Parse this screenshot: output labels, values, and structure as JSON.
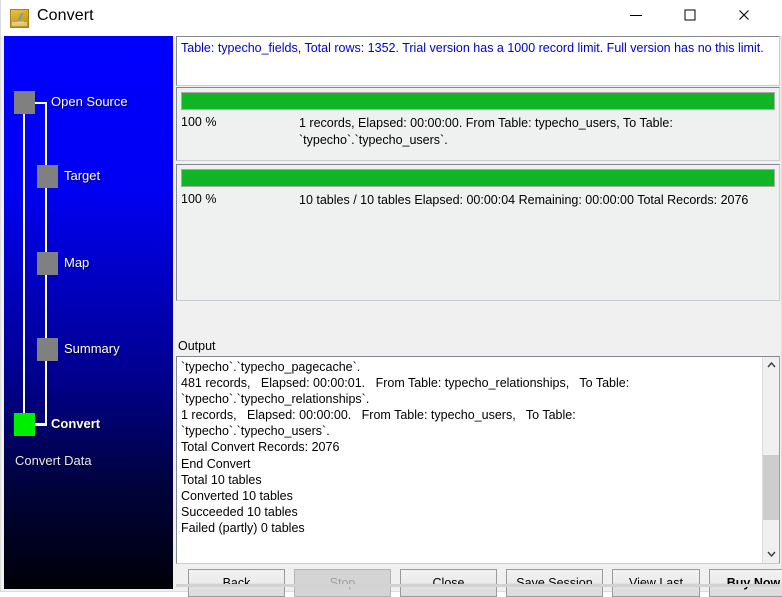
{
  "window": {
    "title": "Convert",
    "icon": "mysql-dolphin-icon",
    "caption_buttons": [
      {
        "name": "minimize-button",
        "glyph": "minimize-icon"
      },
      {
        "name": "maximize-button",
        "glyph": "maximize-icon"
      },
      {
        "name": "close-button",
        "glyph": "close-icon"
      }
    ]
  },
  "sidebar": {
    "footer_label": "Convert Data",
    "steps": [
      {
        "label": "Open Source",
        "state": "done"
      },
      {
        "label": "Target",
        "state": "done"
      },
      {
        "label": "Map",
        "state": "done"
      },
      {
        "label": "Summary",
        "state": "done"
      },
      {
        "label": "Convert",
        "state": "active"
      }
    ],
    "colors": {
      "gradient_top": "#0000FF",
      "gradient_bottom": "#000008",
      "node_done": "#808080",
      "node_active": "#00EE00",
      "connector": "#FFFFFF"
    }
  },
  "notice": {
    "text": "Table: typecho_fields, Total rows: 1352. Trial version has a 1000 record limit. Full version has no this limit.",
    "color": "#0000CC"
  },
  "progress": {
    "accent": "#10B525",
    "current_table": {
      "percent_label": "100 %",
      "percent_value": 100,
      "detail": "1 records,   Elapsed: 00:00:00.   From Table: typecho_users,   To Table: `typecho`.`typecho_users`."
    },
    "overall": {
      "percent_label": "100 %",
      "percent_value": 100,
      "detail": "10 tables / 10 tables   Elapsed: 00:00:04   Remaining: 00:00:00   Total Records: 2076"
    }
  },
  "output": {
    "label": "Output",
    "lines": [
      "`typecho`.`typecho_pagecache`.",
      "481 records,   Elapsed: 00:00:01.   From Table: typecho_relationships,   To Table:",
      "`typecho`.`typecho_relationships`.",
      "1 records,   Elapsed: 00:00:00.   From Table: typecho_users,   To Table:",
      "`typecho`.`typecho_users`.",
      "Total Convert Records: 2076",
      "End Convert",
      "Total 10 tables",
      "Converted 10 tables",
      "Succeeded 10 tables",
      "Failed (partly) 0 tables"
    ],
    "scrollbar": {
      "up_arrow": "chevron-up-icon",
      "down_arrow": "chevron-down-icon"
    }
  },
  "buttons": {
    "back": "Back",
    "stop": "Stop",
    "close": "Close",
    "save_session": "Save Session",
    "view_last": "View Last",
    "buy_now": "Buy Now"
  }
}
